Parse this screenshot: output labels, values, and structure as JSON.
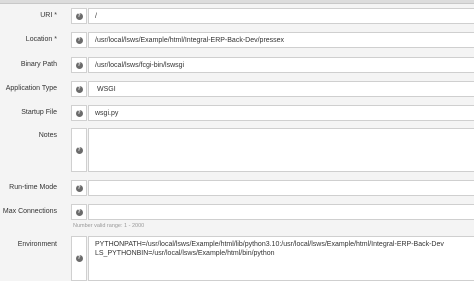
{
  "fields": {
    "uri": {
      "label": "URI",
      "required_mark": "*",
      "value": "/"
    },
    "location": {
      "label": "Location",
      "required_mark": "*",
      "value": "/usr/local/lsws/Example/html/Integral-ERP-Back-Dev/pressex"
    },
    "binary_path": {
      "label": "Binary Path",
      "value": "/usr/local/lsws/fcgi-bin/lswsgi"
    },
    "application_type": {
      "label": "Application Type",
      "value": "WSGI"
    },
    "startup_file": {
      "label": "Startup File",
      "value": "wsgi.py"
    },
    "notes": {
      "label": "Notes",
      "value": ""
    },
    "runtime_mode": {
      "label": "Run-time Mode",
      "value": ""
    },
    "max_connections": {
      "label": "Max Connections",
      "value": "",
      "hint": "Number valid range: 1 - 2000"
    },
    "environment": {
      "label": "Environment",
      "lines": [
        "PYTHONPATH=/usr/local/lsws/Example/html/lib/python3.10:/usr/local/lsws/Example/html/Integral-ERP-Back-Dev",
        "LS_PYTHONBIN=/usr/local/lsws/Example/html/bin/python"
      ]
    }
  },
  "help_icon": "question-circle-icon",
  "colors": {
    "help_icon_bg": "#6b6b6b",
    "field_border": "#cfcfcf",
    "page_bg": "#f4f4f4"
  }
}
